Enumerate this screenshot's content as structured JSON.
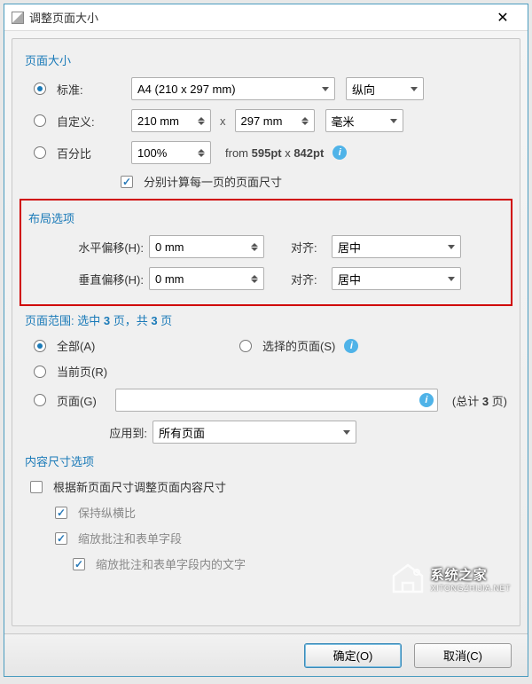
{
  "title": "调整页面大小",
  "page_size": {
    "heading": "页面大小",
    "standard_label": "标准:",
    "standard_value": "A4 (210 x 297 mm)",
    "orientation": "纵向",
    "custom_label": "自定义:",
    "width": "210 mm",
    "height": "297 mm",
    "unit": "毫米",
    "percent_label": "百分比",
    "percent_value": "100%",
    "from_prefix": "from ",
    "from_w": "595pt",
    "from_x": " x ",
    "from_h": "842pt",
    "calc_each": "分别计算每一页的页面尺寸"
  },
  "layout": {
    "heading": "布局选项",
    "h_offset_label": "水平偏移(H):",
    "h_offset_value": "0 mm",
    "v_offset_label": "垂直偏移(H):",
    "v_offset_value": "0 mm",
    "align_label": "对齐:",
    "align_value": "居中"
  },
  "page_range": {
    "heading_prefix": "页面范围: 选中 ",
    "heading_sel": "3",
    "heading_mid": " 页，共 ",
    "heading_total": "3",
    "heading_suffix": " 页",
    "all_label": "全部(A)",
    "selected_label": "选择的页面(S)",
    "current_label": "当前页(R)",
    "pages_label": "页面(G)",
    "pages_value": "",
    "total_prefix": "(总计 ",
    "total_num": "3",
    "total_suffix": " 页)",
    "apply_label": "应用到:",
    "apply_value": "所有页面"
  },
  "content_size": {
    "heading": "内容尺寸选项",
    "resize_content": "根据新页面尺寸调整页面内容尺寸",
    "keep_ratio": "保持纵横比",
    "scale_annot": "缩放批注和表单字段",
    "scale_text": "缩放批注和表单字段内的文字"
  },
  "buttons": {
    "ok": "确定(O)",
    "cancel": "取消(C)"
  },
  "watermark": {
    "brand": "系统之家",
    "url": "XITONGZHIJIA.NET"
  }
}
